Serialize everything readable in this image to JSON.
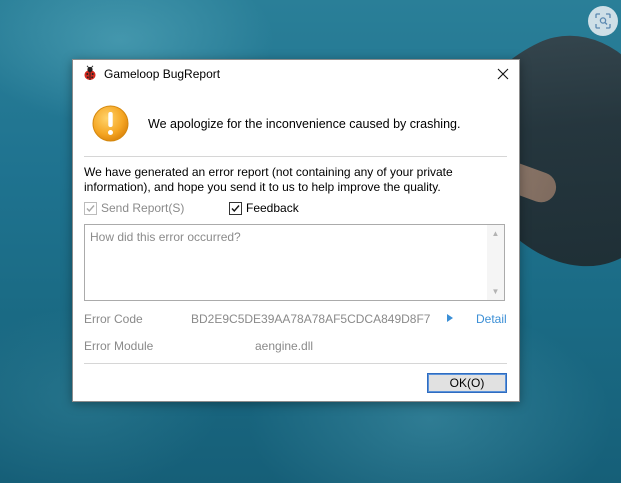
{
  "dialog": {
    "title": "Gameloop BugReport",
    "headline": "We apologize for the inconvenience caused by crashing.",
    "description": "We have generated an error report (not containing any of your private information), and hope you send it to us to help improve the quality.",
    "send_report": {
      "label": "Send Report(S)",
      "checked": true,
      "disabled": true
    },
    "feedback": {
      "label": "Feedback",
      "checked": true
    },
    "feedback_input": {
      "value": "",
      "placeholder": "How did this error occurred?"
    },
    "error_code": {
      "label": "Error Code",
      "value": "BD2E9C5DE39AA78A78AF5CDCA849D8F7"
    },
    "error_module": {
      "label": "Error Module",
      "value": "aengine.dll"
    },
    "detail_link": "Detail",
    "ok_label": "OK(O)"
  },
  "colors": {
    "link": "#3b8fd6",
    "warning": "#f5a623",
    "disabled_text": "#8a8a8a",
    "button_border": "#2f6cc0"
  },
  "icons": [
    "app-ladybug-icon",
    "warning-icon",
    "close-icon",
    "play-triangle-icon",
    "scan-icon"
  ]
}
